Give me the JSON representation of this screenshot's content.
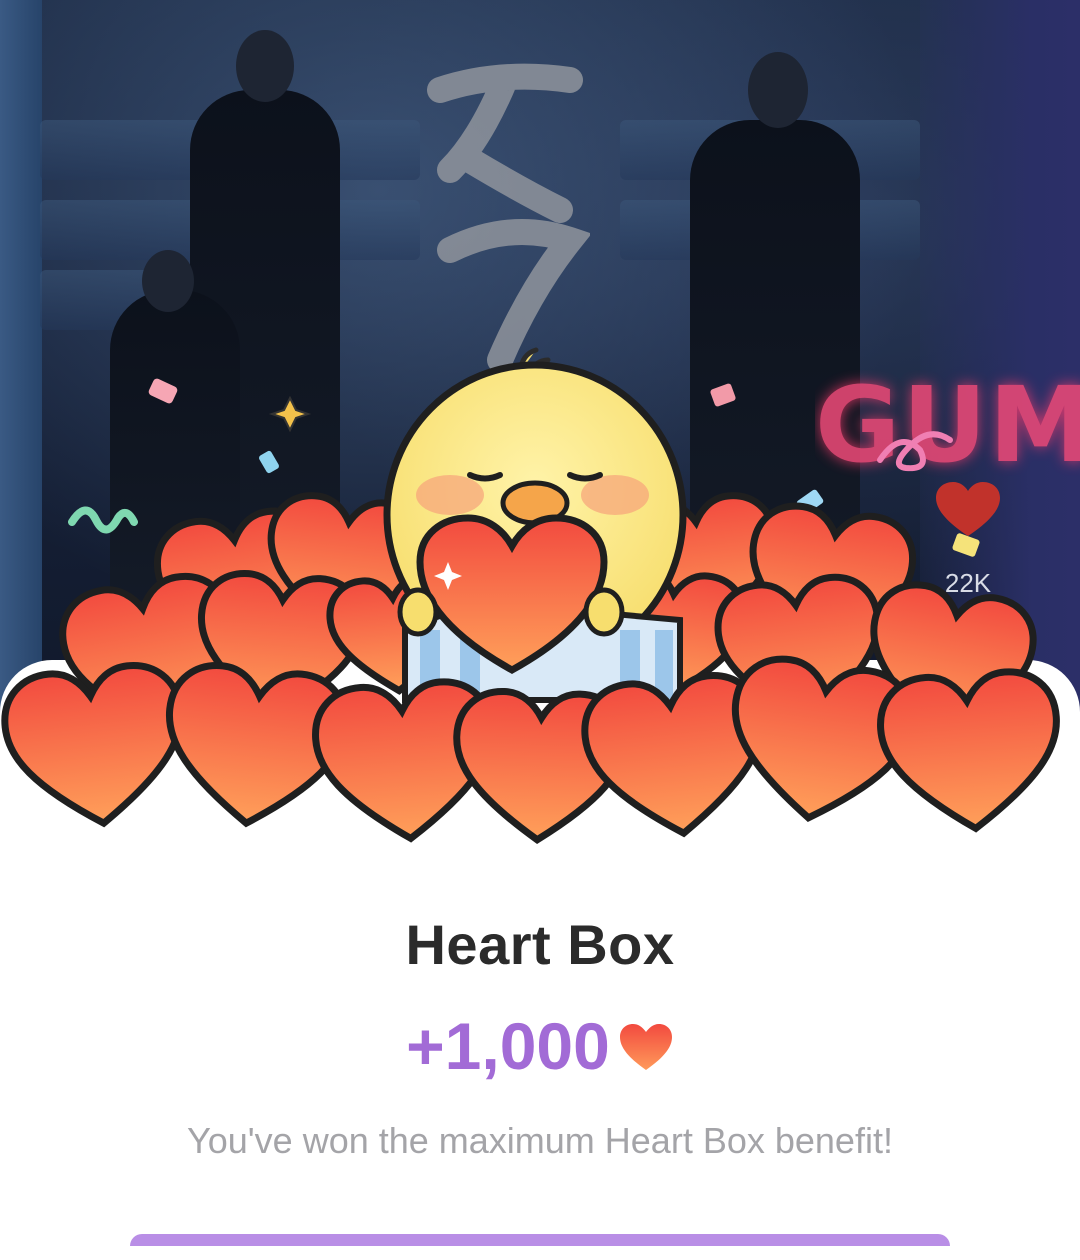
{
  "background": {
    "like_count": "22K",
    "neon_text": "GUM"
  },
  "reward": {
    "title": "Heart Box",
    "amount": "+1,000",
    "message": "You've won the maximum Heart Box benefit!",
    "icon": "heart-icon"
  },
  "colors": {
    "accent_purple": "#a26bd6",
    "heart_red": "#f25b45",
    "heart_orange": "#ff9a5a",
    "chick_yellow": "#fbe98a",
    "title_text": "#2b2b2b",
    "message_text": "#a4a4a8"
  }
}
